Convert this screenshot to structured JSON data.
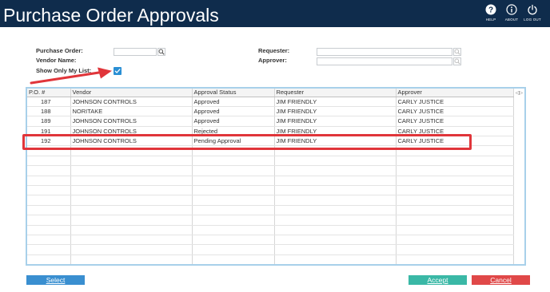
{
  "header": {
    "title": "Purchase Order Approvals",
    "buttons": [
      {
        "label": "HELP",
        "icon": "help-icon"
      },
      {
        "label": "ABOUT",
        "icon": "info-icon"
      },
      {
        "label": "LOG OUT",
        "icon": "power-icon"
      }
    ]
  },
  "filters": {
    "purchase_order_label": "Purchase Order:",
    "purchase_order_value": "",
    "vendor_name_label": "Vendor Name:",
    "show_only_my_list_label": "Show Only My List:",
    "show_only_my_list_checked": true,
    "requester_label": "Requester:",
    "requester_value": "",
    "approver_label": "Approver:",
    "approver_value": ""
  },
  "grid": {
    "columns": [
      "P.O. #",
      "Vendor",
      "Approval Status",
      "Requester",
      "Approver"
    ],
    "rows": [
      [
        "187",
        "JOHNSON CONTROLS",
        "Approved",
        "JIM FRIENDLY",
        "CARLY JUSTICE"
      ],
      [
        "188",
        "NORITAKE",
        "Approved",
        "JIM FRIENDLY",
        "CARLY JUSTICE"
      ],
      [
        "189",
        "JOHNSON CONTROLS",
        "Approved",
        "JIM FRIENDLY",
        "CARLY JUSTICE"
      ],
      [
        "191",
        "JOHNSON CONTROLS",
        "Rejected",
        "JIM FRIENDLY",
        "CARLY JUSTICE"
      ],
      [
        "192",
        "JOHNSON CONTROLS",
        "Pending Approval",
        "JIM FRIENDLY",
        "CARLY JUSTICE"
      ]
    ],
    "resize_handle": "◁▷",
    "highlighted_po": "192"
  },
  "actions": {
    "select_label": "Select",
    "accept_label": "Accept",
    "cancel_label": "Cancel"
  },
  "colors": {
    "header_bg": "#0f2c4c",
    "select_bg": "#3a8fd0",
    "accept_bg": "#3ab8a6",
    "cancel_bg": "#e04848",
    "highlight": "#e0353a",
    "grid_border": "#a8d0ea"
  }
}
